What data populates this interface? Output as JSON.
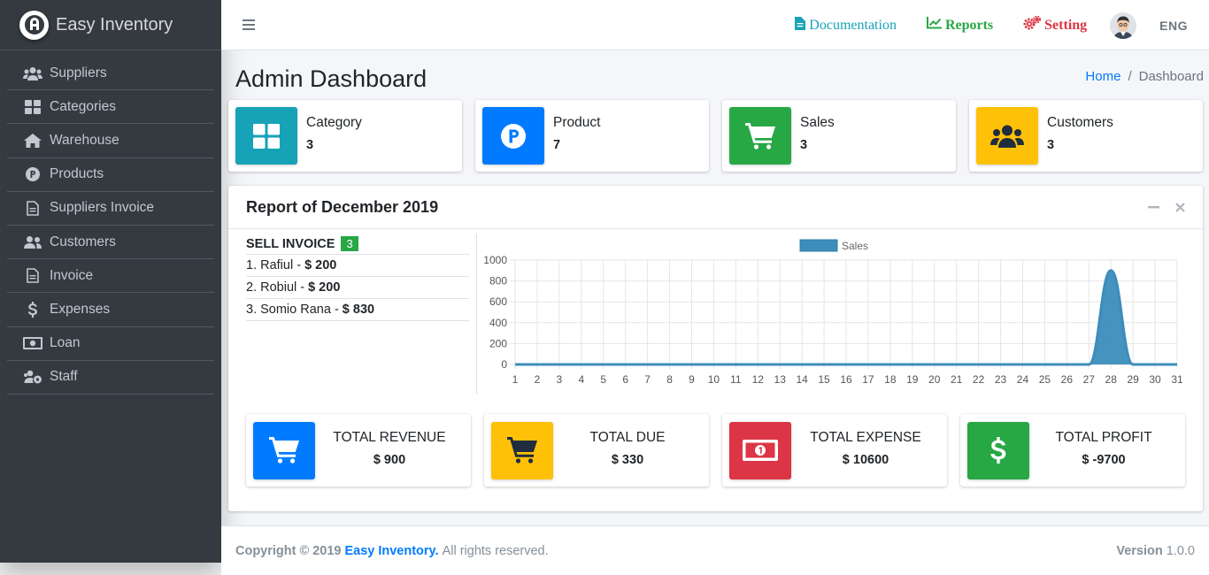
{
  "brand": {
    "name": "Easy Inventory"
  },
  "sidebar": {
    "items": [
      {
        "label": "Suppliers",
        "icon": "users-icon"
      },
      {
        "label": "Categories",
        "icon": "grid-icon"
      },
      {
        "label": "Warehouse",
        "icon": "home-icon"
      },
      {
        "label": "Products",
        "icon": "product-p-icon"
      },
      {
        "label": "Suppliers Invoice",
        "icon": "file-icon"
      },
      {
        "label": "Customers",
        "icon": "user-friends-icon"
      },
      {
        "label": "Invoice",
        "icon": "file-icon"
      },
      {
        "label": "Expenses",
        "icon": "dollar-icon"
      },
      {
        "label": "Loan",
        "icon": "money-bill-icon"
      },
      {
        "label": "Staff",
        "icon": "users-cog-icon"
      }
    ]
  },
  "topbar": {
    "documentation": "Documentation",
    "reports": "Reports",
    "setting": "Setting",
    "language": "ENG"
  },
  "page": {
    "title": "Admin Dashboard",
    "breadcrumb": {
      "home": "Home",
      "separator": "/",
      "current": "Dashboard"
    }
  },
  "info_boxes": [
    {
      "label": "Category",
      "value": "3",
      "color": "#17a2b8",
      "icon": "grid-icon"
    },
    {
      "label": "Product",
      "value": "7",
      "color": "#007bff",
      "icon": "product-p-icon"
    },
    {
      "label": "Sales",
      "value": "3",
      "color": "#28a745",
      "icon": "cart-icon"
    },
    {
      "label": "Customers",
      "value": "3",
      "color": "#ffc107",
      "icon": "users-icon"
    }
  ],
  "report": {
    "title": "Report of December 2019",
    "sell_invoice_label": "SELL INVOICE",
    "sell_invoice_count": "3",
    "invoices": [
      {
        "name": "1. Rafiul -",
        "amount": "$ 200"
      },
      {
        "name": "2. Robiul -",
        "amount": "$ 200"
      },
      {
        "name": "3. Somio Rana -",
        "amount": "$ 830"
      }
    ]
  },
  "chart_data": {
    "type": "area",
    "x": [
      1,
      2,
      3,
      4,
      5,
      6,
      7,
      8,
      9,
      10,
      11,
      12,
      13,
      14,
      15,
      16,
      17,
      18,
      19,
      20,
      21,
      22,
      23,
      24,
      25,
      26,
      27,
      28,
      29,
      30,
      31
    ],
    "series": [
      {
        "name": "Sales",
        "values": [
          0,
          0,
          0,
          0,
          0,
          0,
          0,
          0,
          0,
          0,
          0,
          0,
          0,
          0,
          0,
          0,
          0,
          0,
          0,
          0,
          0,
          0,
          0,
          0,
          0,
          0,
          0,
          900,
          0,
          0,
          0
        ]
      }
    ],
    "yticks": [
      "1000",
      "800",
      "600",
      "400",
      "200",
      "0"
    ],
    "ylim": [
      0,
      1000
    ],
    "legend": "top",
    "grid": true,
    "color": "#3c8dbc"
  },
  "totals": [
    {
      "label": "TOTAL REVENUE",
      "value": "$ 900",
      "color": "#007bff",
      "icon": "cart-icon"
    },
    {
      "label": "TOTAL DUE",
      "value": "$ 330",
      "color": "#ffc107",
      "icon": "cart-icon"
    },
    {
      "label": "TOTAL EXPENSE",
      "value": "$ 10600",
      "color": "#dc3545",
      "icon": "money-bill-icon"
    },
    {
      "label": "TOTAL PROFIT",
      "value": "$ -9700",
      "color": "#28a745",
      "icon": "dollar-icon"
    }
  ],
  "footer": {
    "copyright": "Copyright © 2019",
    "brand": "Easy Inventory.",
    "rights": "All rights reserved.",
    "version_label": "Version",
    "version": "1.0.0"
  }
}
